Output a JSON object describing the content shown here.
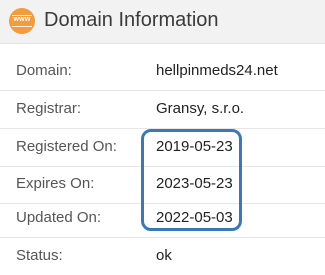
{
  "header": {
    "icon_text": "www",
    "title": "Domain Information"
  },
  "rows": [
    {
      "label": "Domain:",
      "value": "hellpinmeds24.net"
    },
    {
      "label": "Registrar:",
      "value": "Gransy, s.r.o."
    },
    {
      "label": "Registered On:",
      "value": "2019-05-23"
    },
    {
      "label": "Expires On:",
      "value": "2023-05-23"
    },
    {
      "label": "Updated On:",
      "value": "2022-05-03"
    },
    {
      "label": "Status:",
      "value": "ok"
    }
  ],
  "colors": {
    "icon_orange": "#f39c3d",
    "highlight_blue": "#3a78b8"
  }
}
